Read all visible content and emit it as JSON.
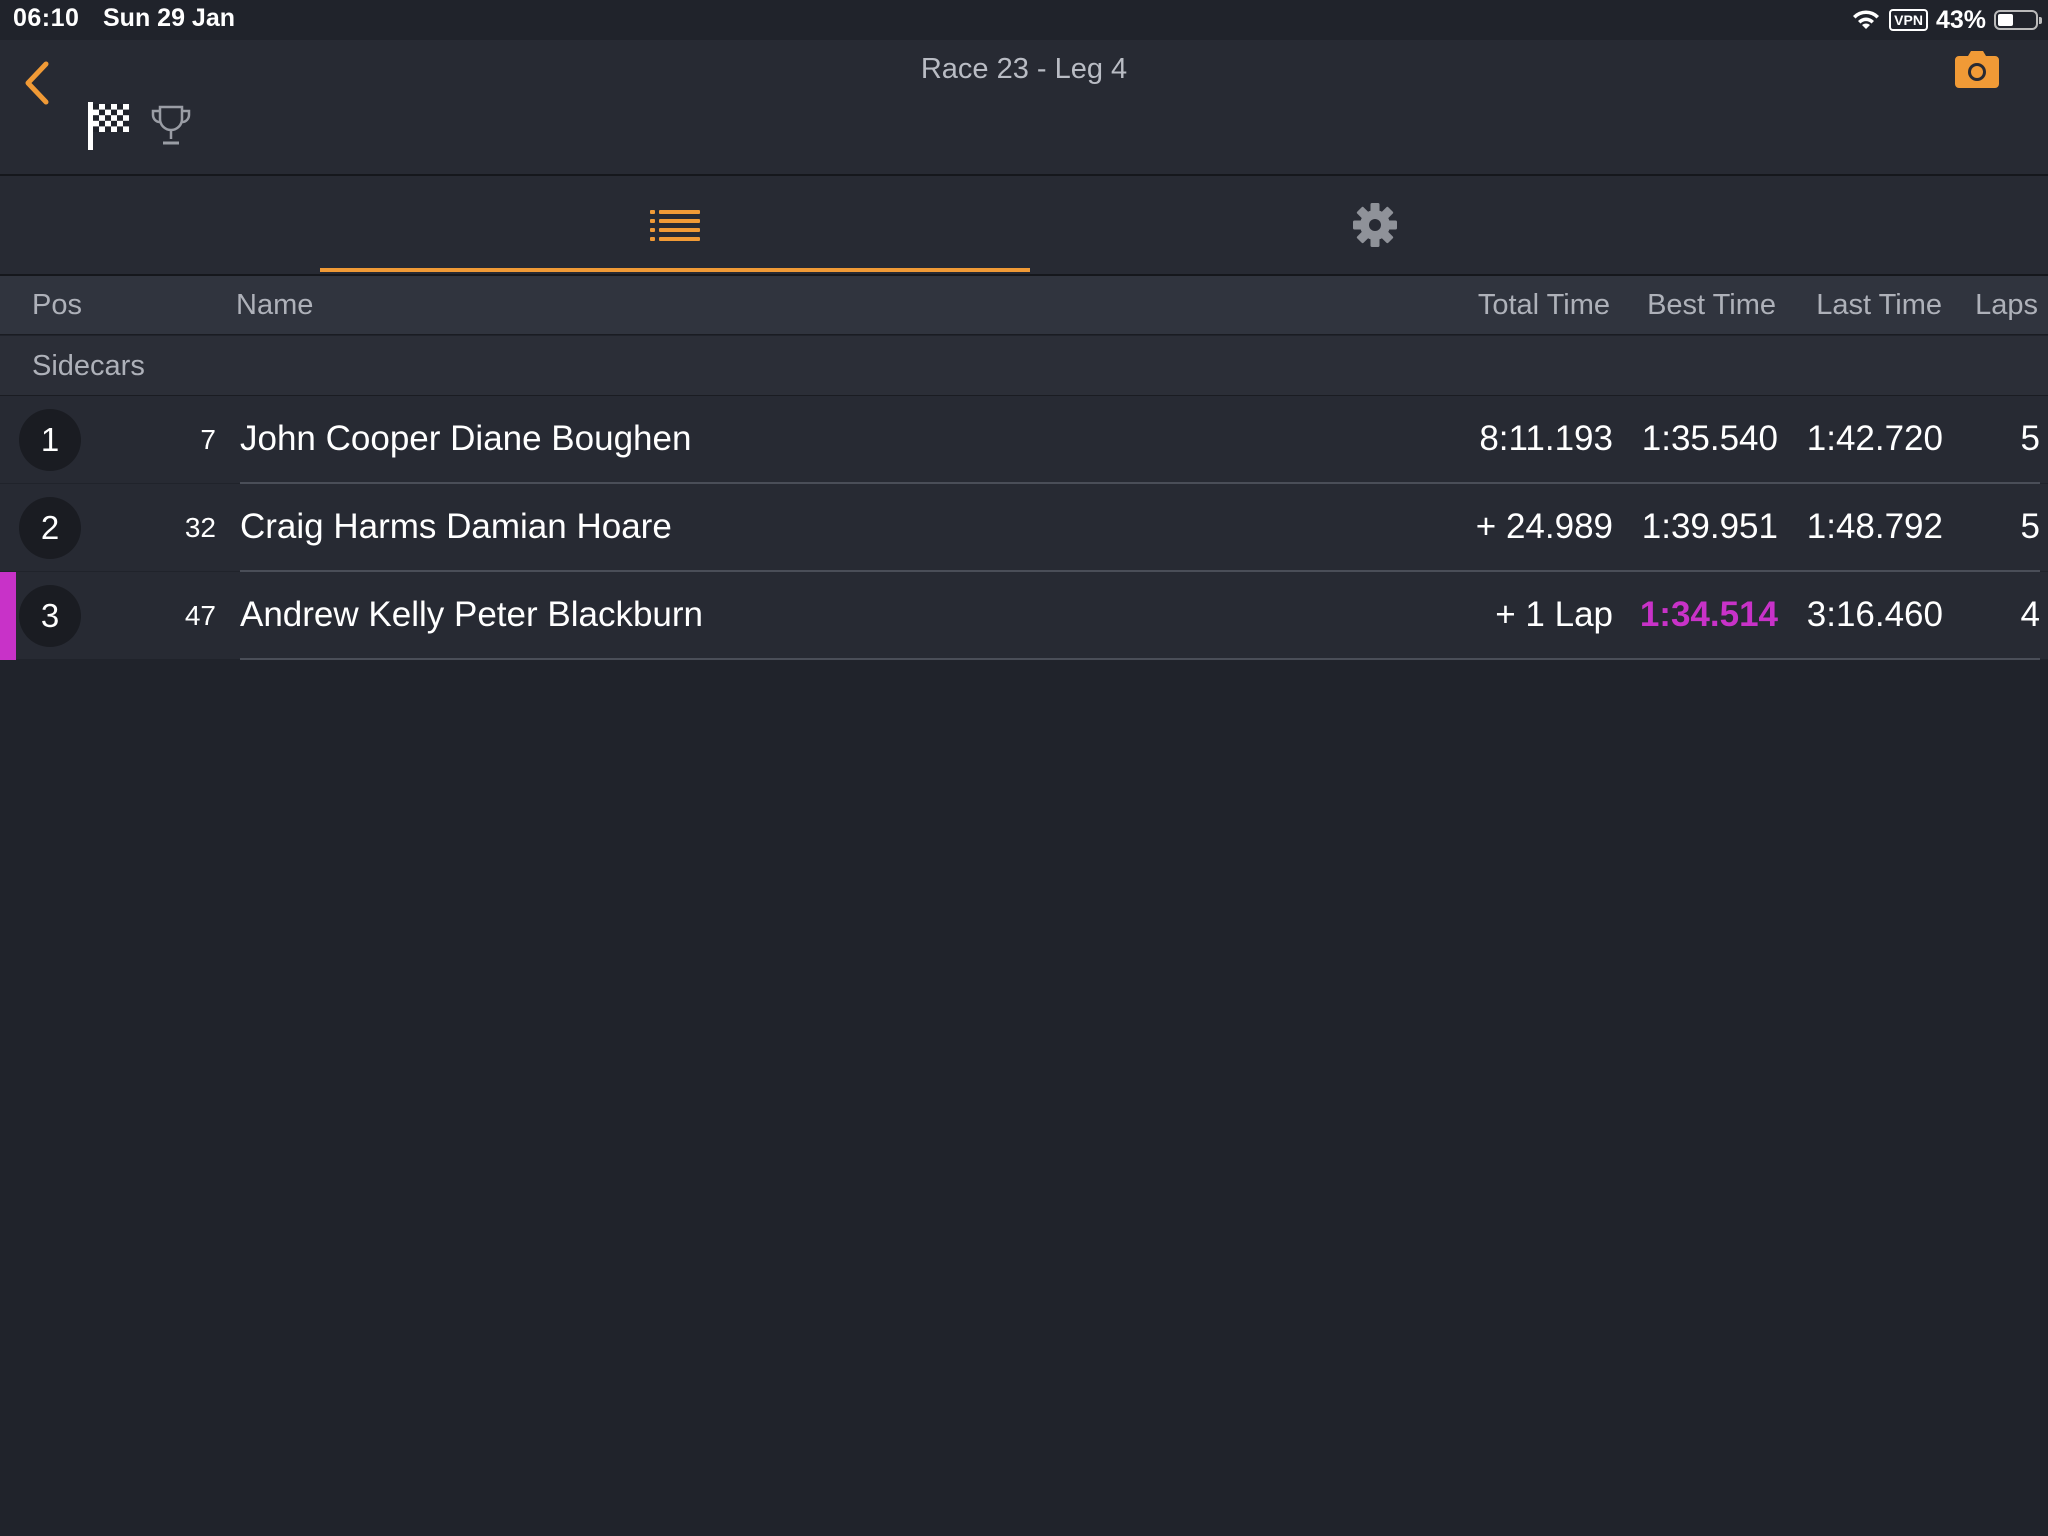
{
  "status_bar": {
    "time": "06:10",
    "date": "Sun 29 Jan",
    "vpn": "VPN",
    "battery": "43%",
    "battery_level": 0.43
  },
  "header": {
    "title": "Race 23 - Leg 4",
    "back_icon": "chevron-left-icon",
    "flag_icon": "checkered-flag-icon",
    "trophy_icon": "trophy-icon",
    "camera_icon": "camera-icon"
  },
  "tabs": [
    {
      "name": "results-list",
      "icon": "list-icon",
      "active": true
    },
    {
      "name": "settings",
      "icon": "gear-icon",
      "active": false
    }
  ],
  "columns": {
    "pos": "Pos",
    "name": "Name",
    "total": "Total Time",
    "best": "Best Time",
    "last": "Last Time",
    "laps": "Laps"
  },
  "group": "Sidecars",
  "rows": [
    {
      "pos": "1",
      "number": "7",
      "name": "John Cooper Diane Boughen",
      "total": "8:11.193",
      "best": "1:35.540",
      "last": "1:42.720",
      "laps": "5"
    },
    {
      "pos": "2",
      "number": "32",
      "name": "Craig Harms Damian Hoare",
      "total": "+ 24.989",
      "best": "1:39.951",
      "last": "1:48.792",
      "laps": "5"
    },
    {
      "pos": "3",
      "number": "47",
      "name": "Andrew Kelly Peter Blackburn",
      "total": "+ 1 Lap",
      "best": "1:34.514",
      "last": "3:16.460",
      "laps": "4"
    }
  ],
  "colors": {
    "accent": "#f09a36",
    "fastest_lap": "#c832c8",
    "background": "#20232b"
  }
}
